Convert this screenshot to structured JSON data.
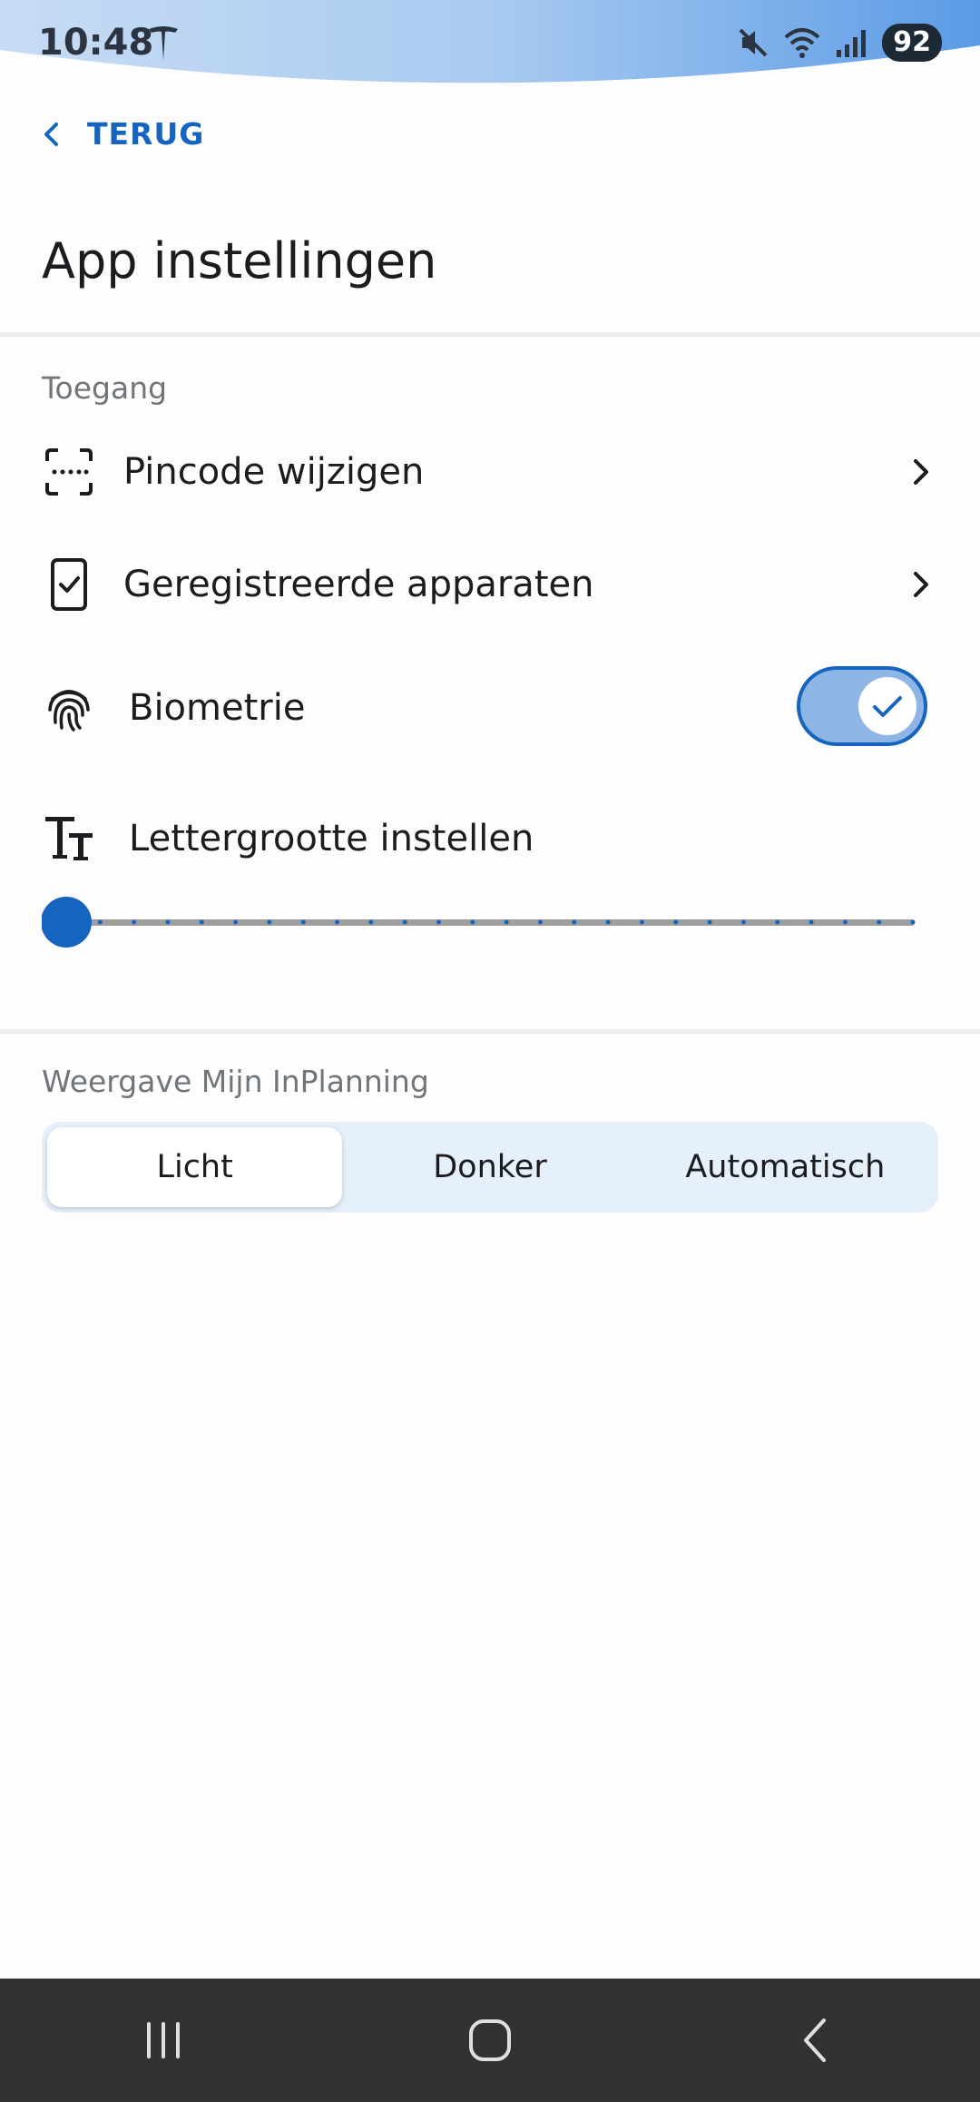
{
  "status_bar": {
    "time": "10:48",
    "battery": "92",
    "icons": [
      "tesla-icon",
      "mute-icon",
      "wifi-icon",
      "signal-icon"
    ]
  },
  "nav": {
    "back_label": "TERUG",
    "back_icon": "chevron-left-icon"
  },
  "page": {
    "title": "App instellingen"
  },
  "access": {
    "section_label": "Toegang",
    "items": [
      {
        "label": "Pincode wijzigen",
        "icon": "pincode-icon"
      },
      {
        "label": "Geregistreerde apparaten",
        "icon": "device-check-icon"
      },
      {
        "label": "Biometrie",
        "icon": "fingerprint-icon",
        "toggle_on": true
      },
      {
        "label": "Lettergrootte instellen",
        "icon": "text-size-icon"
      }
    ],
    "font_size_slider": {
      "value_step": 0,
      "steps": 25
    }
  },
  "display": {
    "section_label": "Weergave Mijn InPlanning",
    "options": [
      "Licht",
      "Donker",
      "Automatisch"
    ],
    "selected": "Licht"
  },
  "colors": {
    "accent": "#1565c0",
    "toggle_track": "#8db6e6",
    "segment_bg": "#e6f0fb",
    "navbar": "#323232"
  }
}
